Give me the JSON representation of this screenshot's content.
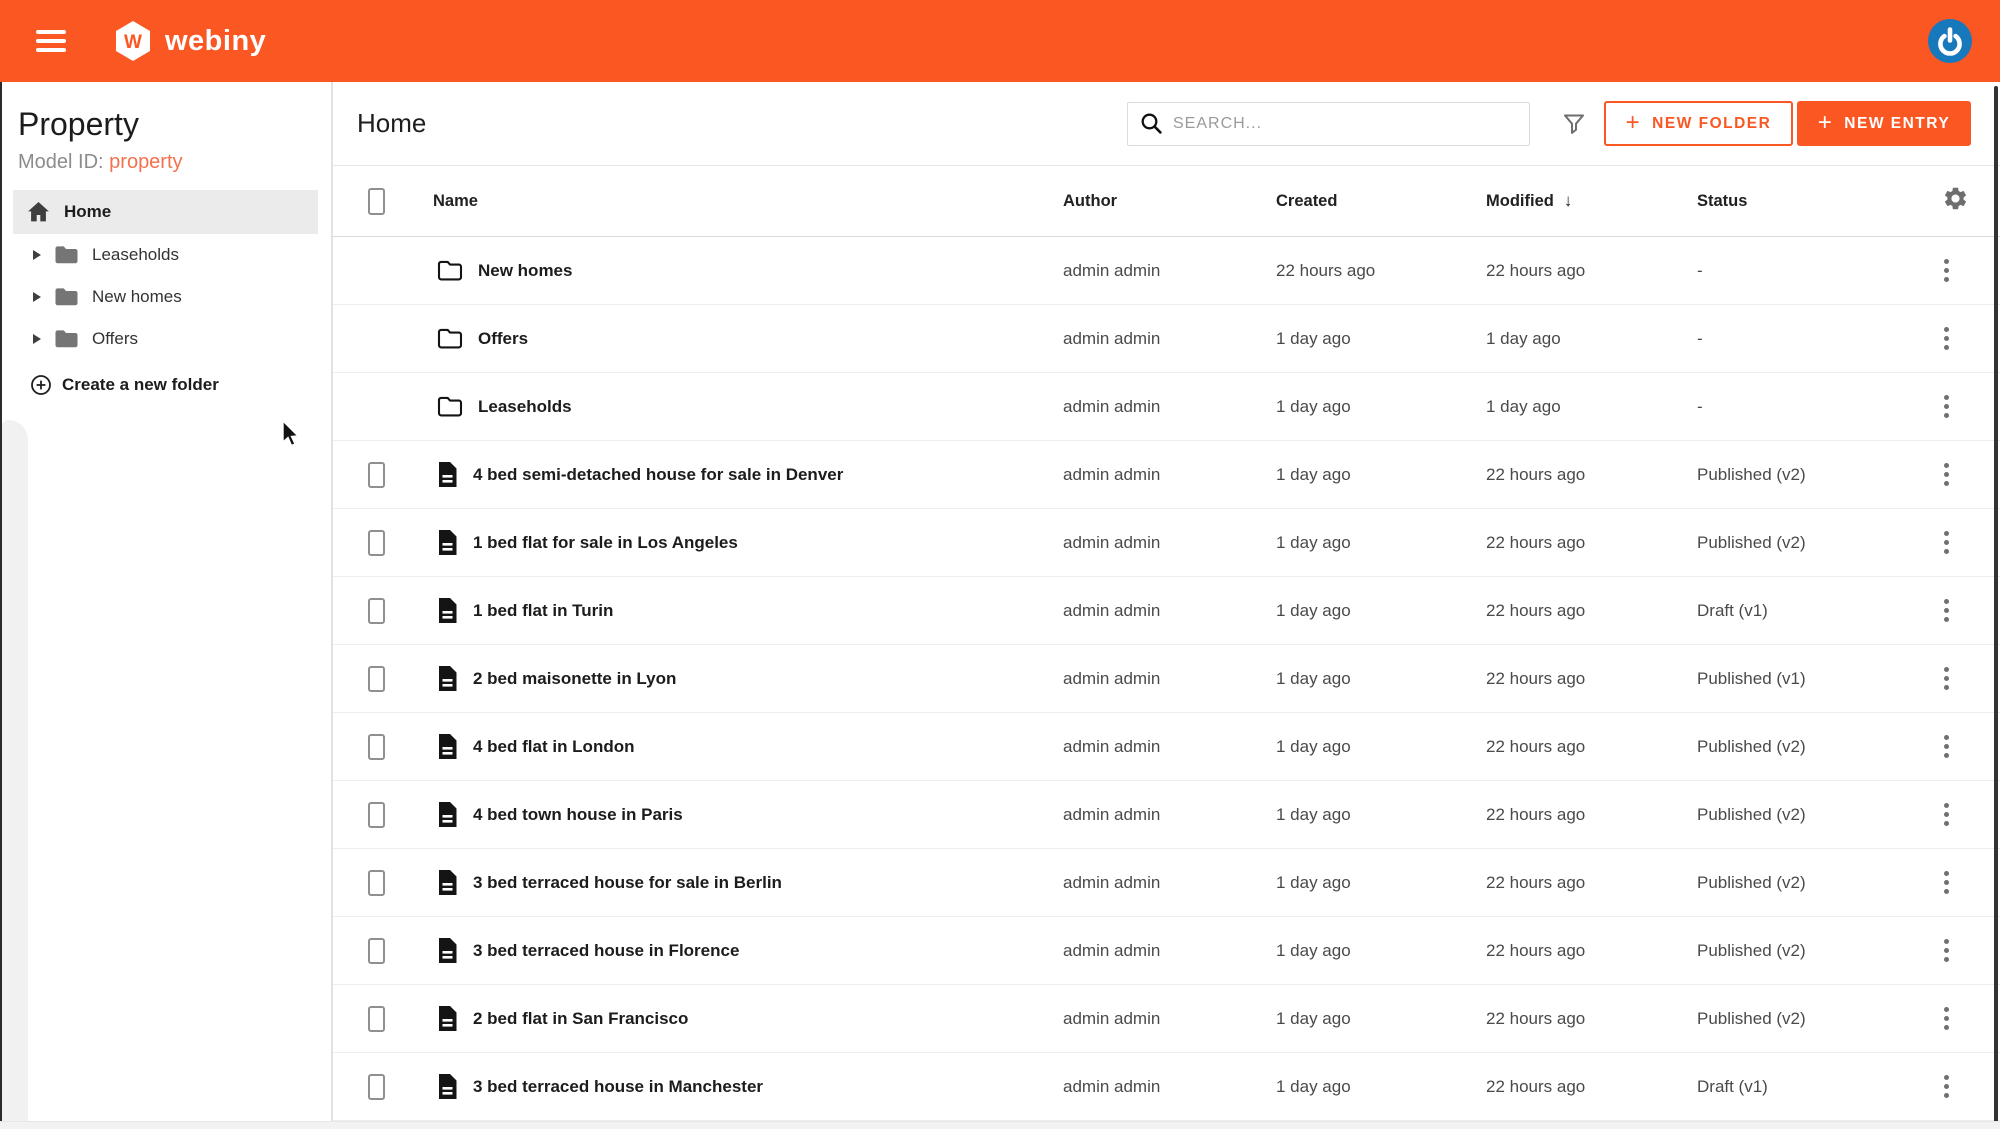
{
  "header": {
    "brand": "webiny"
  },
  "sidebar": {
    "title": "Property",
    "model_id_label": "Model ID:",
    "model_id_value": "property",
    "home_label": "Home",
    "folders": [
      {
        "label": "Leaseholds"
      },
      {
        "label": "New homes"
      },
      {
        "label": "Offers"
      }
    ],
    "create_folder_label": "Create a new folder"
  },
  "main": {
    "title": "Home",
    "search_placeholder": "SEARCH...",
    "plus": "+",
    "new_folder_label": "NEW FOLDER",
    "new_entry_label": "NEW ENTRY"
  },
  "table": {
    "columns": [
      "Name",
      "Author",
      "Created",
      "Modified",
      "Status"
    ],
    "sort_column": "Modified",
    "sort_direction": "desc",
    "sort_indicator": "↓",
    "rows": [
      {
        "type": "folder",
        "name": "New homes",
        "author": "admin admin",
        "created": "22 hours ago",
        "modified": "22 hours ago",
        "status": "-"
      },
      {
        "type": "folder",
        "name": "Offers",
        "author": "admin admin",
        "created": "1 day ago",
        "modified": "1 day ago",
        "status": "-"
      },
      {
        "type": "folder",
        "name": "Leaseholds",
        "author": "admin admin",
        "created": "1 day ago",
        "modified": "1 day ago",
        "status": "-"
      },
      {
        "type": "entry",
        "name": "4 bed semi-detached house for sale in Denver",
        "author": "admin admin",
        "created": "1 day ago",
        "modified": "22 hours ago",
        "status": "Published (v2)"
      },
      {
        "type": "entry",
        "name": "1 bed flat for sale in Los Angeles",
        "author": "admin admin",
        "created": "1 day ago",
        "modified": "22 hours ago",
        "status": "Published (v2)"
      },
      {
        "type": "entry",
        "name": "1 bed flat in Turin",
        "author": "admin admin",
        "created": "1 day ago",
        "modified": "22 hours ago",
        "status": "Draft (v1)"
      },
      {
        "type": "entry",
        "name": "2 bed maisonette in Lyon",
        "author": "admin admin",
        "created": "1 day ago",
        "modified": "22 hours ago",
        "status": "Published (v1)"
      },
      {
        "type": "entry",
        "name": "4 bed flat in London",
        "author": "admin admin",
        "created": "1 day ago",
        "modified": "22 hours ago",
        "status": "Published (v2)"
      },
      {
        "type": "entry",
        "name": "4 bed town house in Paris",
        "author": "admin admin",
        "created": "1 day ago",
        "modified": "22 hours ago",
        "status": "Published (v2)"
      },
      {
        "type": "entry",
        "name": "3 bed terraced house for sale in Berlin",
        "author": "admin admin",
        "created": "1 day ago",
        "modified": "22 hours ago",
        "status": "Published (v2)"
      },
      {
        "type": "entry",
        "name": "3 bed terraced house in Florence",
        "author": "admin admin",
        "created": "1 day ago",
        "modified": "22 hours ago",
        "status": "Published (v2)"
      },
      {
        "type": "entry",
        "name": "2 bed flat in San Francisco",
        "author": "admin admin",
        "created": "1 day ago",
        "modified": "22 hours ago",
        "status": "Published (v2)"
      },
      {
        "type": "entry",
        "name": "3 bed terraced house in Manchester",
        "author": "admin admin",
        "created": "1 day ago",
        "modified": "22 hours ago",
        "status": "Draft (v1)"
      }
    ]
  },
  "colors": {
    "primary_orange": "#FA5723",
    "model_link": "#F3714E",
    "avatar_blue": "#1878BC",
    "selected_item_bg": "#EBEBEB"
  }
}
